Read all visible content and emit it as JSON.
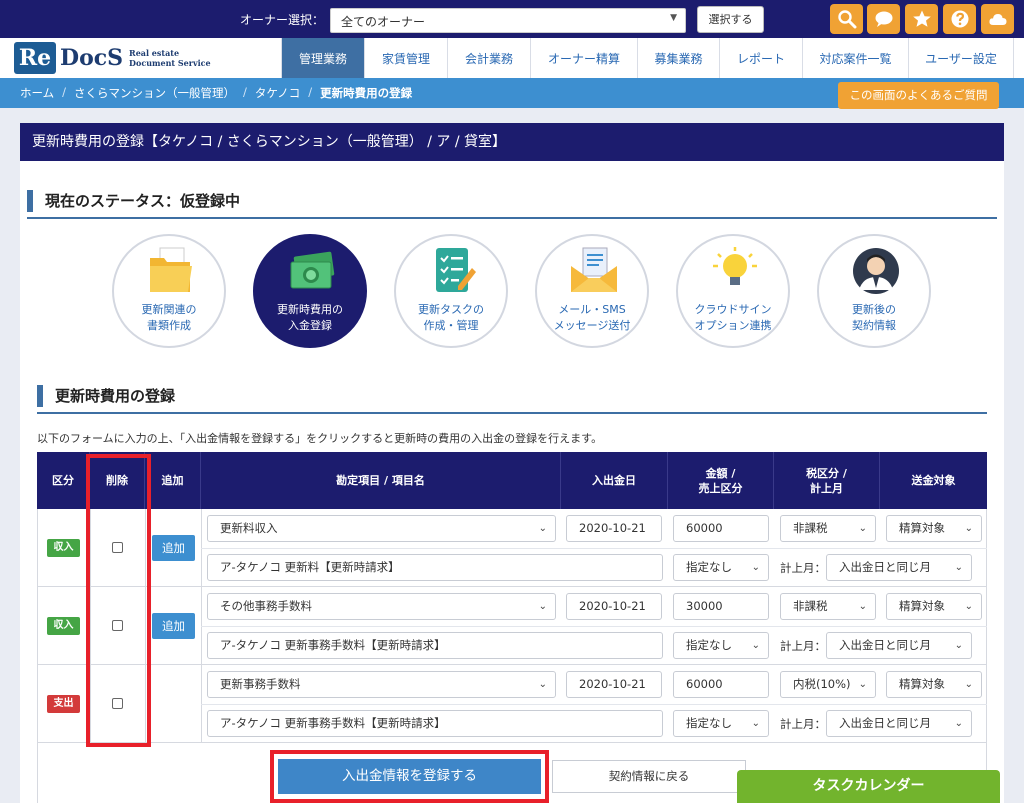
{
  "topbar": {
    "owner_label": "オーナー選択：",
    "owner_select_value": "全てのオーナー",
    "select_button": "選択する"
  },
  "logo": {
    "re": "Re",
    "docs": "DocS",
    "sub1": "Real estate",
    "sub2": "Document Service"
  },
  "nav": {
    "items": [
      "管理業務",
      "家賃管理",
      "会計業務",
      "オーナー精算",
      "募集業務",
      "レポート",
      "対応案件一覧",
      "ユーザー設定"
    ],
    "active_index": 0
  },
  "breadcrumb": {
    "items": [
      "ホーム",
      "さくらマンション（一般管理）",
      "タケノコ",
      "更新時費用の登録"
    ],
    "separator": "/"
  },
  "faq_button": "この画面のよくあるご質問",
  "panel_title": "更新時費用の登録【タケノコ / さくらマンション（一般管理） / ア / 貸室】",
  "status_title": "現在のステータス：仮登録中",
  "steps": [
    {
      "line1": "更新関連の",
      "line2": "書類作成"
    },
    {
      "line1": "更新時費用の",
      "line2": "入金登録"
    },
    {
      "line1": "更新タスクの",
      "line2": "作成・管理"
    },
    {
      "line1": "メール・SMS",
      "line2": "メッセージ送付"
    },
    {
      "line1": "クラウドサイン",
      "line2": "オプション連携"
    },
    {
      "line1": "更新後の",
      "line2": "契約情報"
    }
  ],
  "section_title": "更新時費用の登録",
  "description": "以下のフォームに入力の上、「入出金情報を登録する」をクリックすると更新時の費用の入出金の登録を行えます。",
  "table": {
    "headers": {
      "kubun": "区分",
      "delete": "削除",
      "add": "追加",
      "item_line1": "勘定項目 / 項目名",
      "date": "入出金日",
      "amount_line1": "金額 /",
      "amount_line2": "売上区分",
      "tax_line1": "税区分 /",
      "tax_line2": "計上月",
      "target": "送金対象"
    },
    "add_label": "追加",
    "month_label": "計上月：",
    "rows": [
      {
        "type": "収入",
        "account": "更新料収入",
        "date": "2020-10-21",
        "amount": "60000",
        "tax": "非課税",
        "target": "精算対象",
        "name": "ア-タケノコ 更新料【更新時請求】",
        "sales": "指定なし",
        "month": "入出金日と同じ月"
      },
      {
        "type": "収入",
        "account": "その他事務手数料",
        "date": "2020-10-21",
        "amount": "30000",
        "tax": "非課税",
        "target": "精算対象",
        "name": "ア-タケノコ 更新事務手数料【更新時請求】",
        "sales": "指定なし",
        "month": "入出金日と同じ月"
      },
      {
        "type": "支出",
        "account": "更新事務手数料",
        "date": "2020-10-21",
        "amount": "60000",
        "tax": "内税(10%)",
        "target": "精算対象",
        "name": "ア-タケノコ 更新事務手数料【更新時請求】",
        "sales": "指定なし",
        "month": "入出金日と同じ月"
      }
    ]
  },
  "register_button": "入出金情報を登録する",
  "back_button": "契約情報に戻る",
  "task_calendar": "タスクカレンダー",
  "colors": {
    "navy": "#1c1c6e",
    "accent_blue": "#3d8fd0",
    "orange": "#f0a234",
    "green": "#72b42d",
    "red_highlight": "#e8202a"
  }
}
